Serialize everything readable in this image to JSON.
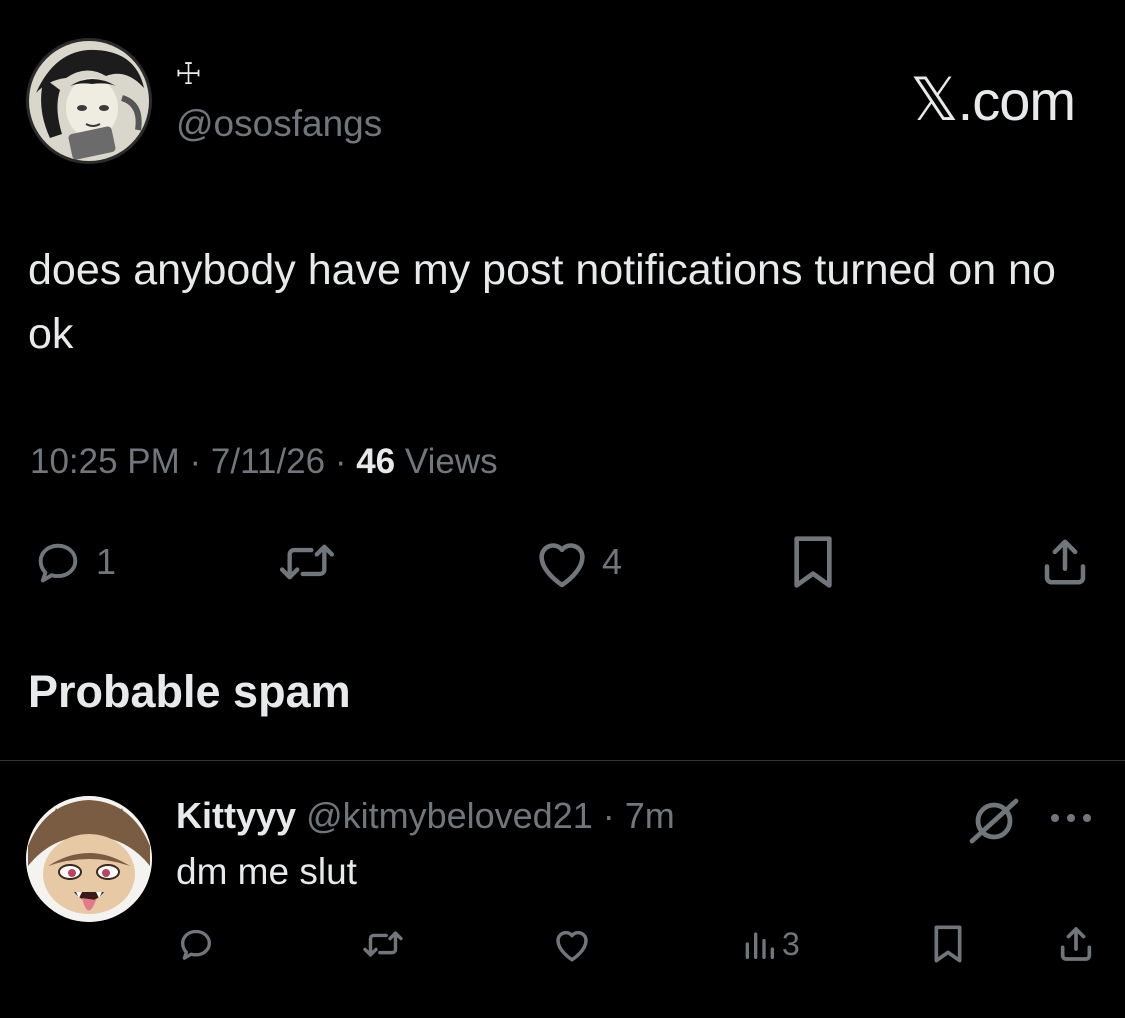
{
  "post": {
    "display_name": "☩",
    "handle": "@ososfangs",
    "text": "does anybody have my post notifications turned on no ok",
    "time": "10:25 PM",
    "date": "7/11/26",
    "views_count": "46",
    "views_label": "Views",
    "separator": " · ",
    "actions": {
      "reply_count": "1",
      "like_count": "4"
    }
  },
  "brand": {
    "x": "𝕏",
    "domain": ".com"
  },
  "section": {
    "title": "Probable spam"
  },
  "reply": {
    "display_name": "Kittyyy",
    "handle": "@kitmybeloved21",
    "separator": " · ",
    "time": "7m",
    "text": "dm me slut",
    "views_count": "3"
  },
  "icons": {
    "reply": "reply-icon",
    "repost": "repost-icon",
    "like": "heart-icon",
    "bookmark": "bookmark-icon",
    "share": "share-icon",
    "views": "views-icon",
    "grok": "grok-icon",
    "more": "more-icon"
  },
  "colors": {
    "background": "#000000",
    "text_primary": "#e7e9ea",
    "text_secondary": "#71767b",
    "divider": "#2f3336"
  }
}
